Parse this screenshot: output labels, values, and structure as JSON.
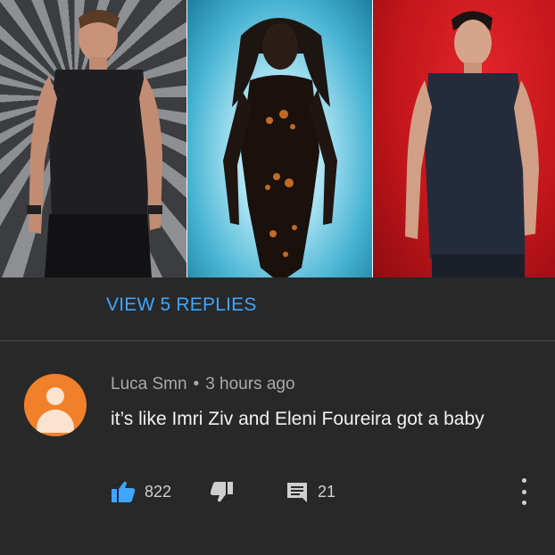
{
  "replies": {
    "label": "VIEW 5 REPLIES"
  },
  "comment": {
    "author": "Luca Smn",
    "separator": "•",
    "time": "3 hours ago",
    "text": "it’s like Imri Ziv and Eleni Foureira got a baby",
    "likes": "822",
    "replies_count": "21"
  },
  "icons": {
    "like": "thumb-up-icon",
    "dislike": "thumb-down-icon",
    "reply": "comment-icon",
    "more": "more-vertical-icon"
  },
  "colors": {
    "background": "#282828",
    "link": "#3ea6ff",
    "avatar": "#f0802a",
    "like_active": "#3ea6ff"
  }
}
